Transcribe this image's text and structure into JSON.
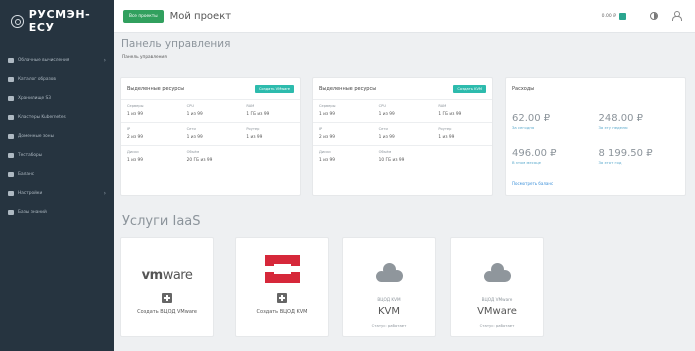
{
  "brand": "РУСМЭН-ЕСУ",
  "sidebar": {
    "items": [
      {
        "label": "Облачные вычисления",
        "chevron": true
      },
      {
        "label": "Каталог образов",
        "chevron": false
      },
      {
        "label": "Хранилище S3",
        "chevron": false
      },
      {
        "label": "Кластеры Kubernetes",
        "chevron": false
      },
      {
        "label": "Доменные зоны",
        "chevron": false
      },
      {
        "label": "Тестаборы",
        "chevron": false
      },
      {
        "label": "Баланс",
        "chevron": false
      },
      {
        "label": "Настройки",
        "chevron": true
      },
      {
        "label": "Базы знаний",
        "chevron": false
      }
    ]
  },
  "topbar": {
    "project_button": "Все проекты",
    "project_title": "Мой проект",
    "balance": "0.00 ₽",
    "accent": "#31a05e"
  },
  "page": {
    "title": "Панель управления",
    "breadcrumb": "Панель управления"
  },
  "resources": [
    {
      "title": "Выделенные ресурсы",
      "badge": "Создать VMware",
      "rows": [
        [
          {
            "label": "Серверы",
            "value": "1 из 99"
          },
          {
            "label": "CPU",
            "value": "1 из 99"
          },
          {
            "label": "RAM",
            "value": "1 ГБ из 99"
          }
        ],
        [
          {
            "label": "IP",
            "value": "2 из 99"
          },
          {
            "label": "Сети",
            "value": "1 из 99"
          },
          {
            "label": "Роутер",
            "value": "1 из 99"
          }
        ],
        [
          {
            "label": "Диски",
            "value": "1 из 99"
          },
          {
            "label": "Объём",
            "value": "20 ГБ из 99"
          },
          {
            "label": "",
            "value": ""
          }
        ]
      ]
    },
    {
      "title": "Выделенные ресурсы",
      "badge": "Создать KVM",
      "rows": [
        [
          {
            "label": "Серверы",
            "value": "1 из 99"
          },
          {
            "label": "CPU",
            "value": "1 из 99"
          },
          {
            "label": "RAM",
            "value": "1 ГБ из 99"
          }
        ],
        [
          {
            "label": "IP",
            "value": "2 из 99"
          },
          {
            "label": "Сети",
            "value": "1 из 99"
          },
          {
            "label": "Роутер",
            "value": "1 из 99"
          }
        ],
        [
          {
            "label": "Диски",
            "value": "1 из 99"
          },
          {
            "label": "Объём",
            "value": "10 ГБ из 99"
          },
          {
            "label": "",
            "value": ""
          }
        ]
      ]
    }
  ],
  "expenses": {
    "title": "Расходы",
    "items": [
      {
        "amount": "62.00 ₽",
        "caption": "За сегодня"
      },
      {
        "amount": "248.00 ₽",
        "caption": "За эту неделю"
      },
      {
        "amount": "496.00 ₽",
        "caption": "В этом месяце"
      },
      {
        "amount": "8 199.50 ₽",
        "caption": "За этот год"
      }
    ],
    "link": "Посмотреть баланс"
  },
  "iaas": {
    "title": "Услуги IaaS",
    "services": [
      {
        "kind": "create",
        "logo": "vmware-logo",
        "label": "Создать ВЦОД VMware"
      },
      {
        "kind": "create",
        "logo": "openstack-logo",
        "label": "Создать ВЦОД KVM"
      },
      {
        "kind": "existing",
        "sub": "ВЦОД KVM",
        "name": "KVM",
        "status": "Статус: работает"
      },
      {
        "kind": "existing",
        "sub": "ВЦОД VMware",
        "name": "VMware",
        "status": "Статус: работает"
      }
    ]
  },
  "vmware_word": {
    "vm": "vm",
    "ware": "ware"
  }
}
